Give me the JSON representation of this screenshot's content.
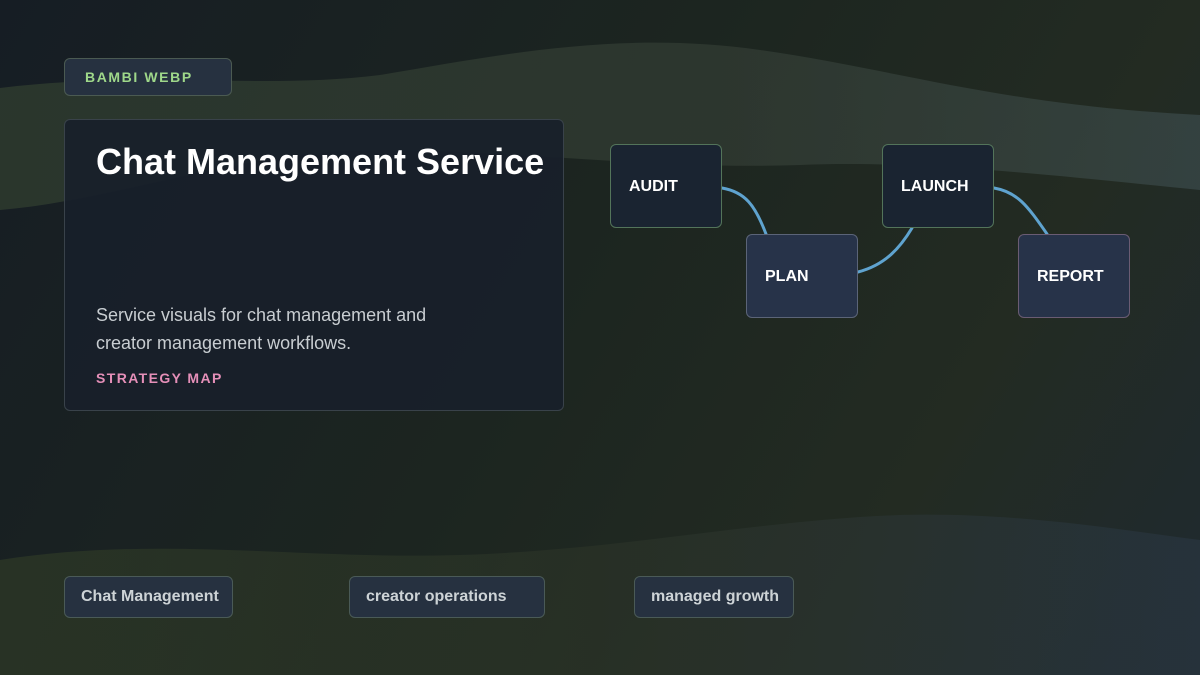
{
  "badge": {
    "label": "BAMBI WEBP"
  },
  "hero": {
    "title": "Chat Management Service",
    "description": "Service visuals for chat management and creator management workflows.",
    "tag": "STRATEGY MAP"
  },
  "flow": {
    "steps": [
      "AUDIT",
      "PLAN",
      "LAUNCH",
      "REPORT"
    ],
    "connector_color": "#5fa3cf"
  },
  "chips": [
    "Chat Management",
    "creator operations",
    "managed growth"
  ],
  "colors": {
    "badge_text": "#9fd88a",
    "tag_text": "#e58fb8",
    "title_text": "#ffffff"
  }
}
